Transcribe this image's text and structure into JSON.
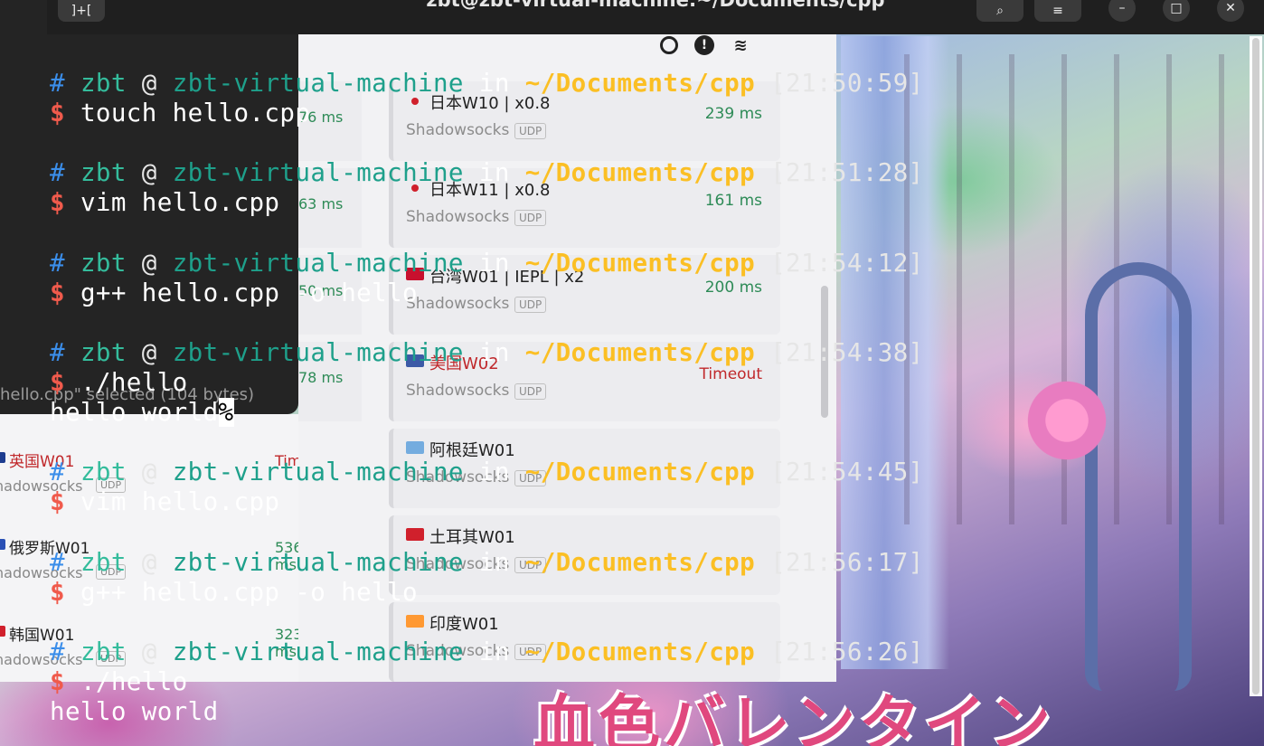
{
  "window": {
    "title": "zbt@zbt-virtual-machine:~/Documents/cpp",
    "new_tab_icon": "new-tab-icon",
    "search_icon": "search-icon",
    "menu_icon": "menu-icon",
    "minimize_icon": "minimize-icon",
    "maximize_icon": "maximize-icon",
    "close_icon": "close-icon"
  },
  "background_app": {
    "status_text": "hello.cpp\" selected (104 bytes)",
    "left_items": [
      {
        "name": "英国W01",
        "latency": "Timeout",
        "protocol": "hadowsocks",
        "badge": "UDP",
        "flag_color": "#1d3c8f",
        "red": true
      },
      {
        "name": "俄罗斯W01",
        "latency": "536 ms",
        "protocol": "hadowsocks",
        "badge": "UDP",
        "flag_color": "#2a50b5",
        "red": false
      },
      {
        "name": "韩国W01",
        "latency": "323 ms",
        "protocol": "hadowsocks",
        "badge": "UDP",
        "flag_color": "#d0202c",
        "red": false
      }
    ],
    "left_latencies": [
      "76 ms",
      "63 ms",
      "50 ms",
      "78 ms"
    ],
    "cards": [
      {
        "name": "日本W10 | x0.8",
        "protocol": "Shadowsocks",
        "badge": "UDP",
        "latency": "239 ms",
        "timeout": false,
        "red": false,
        "flag": "dot"
      },
      {
        "name": "日本W11 | x0.8",
        "protocol": "Shadowsocks",
        "badge": "UDP",
        "latency": "161 ms",
        "timeout": false,
        "red": false,
        "flag": "dot"
      },
      {
        "name": "台湾W01 | IEPL | x2",
        "protocol": "Shadowsocks",
        "badge": "UDP",
        "latency": "200 ms",
        "timeout": false,
        "red": false,
        "flag": "#c8102e"
      },
      {
        "name": "美国W02",
        "protocol": "Shadowsocks",
        "badge": "UDP",
        "latency": "Timeout",
        "timeout": true,
        "red": true,
        "flag": "#3c5aa6"
      },
      {
        "name": "阿根廷W01",
        "protocol": "Shadowsocks",
        "badge": "UDP",
        "latency": "",
        "timeout": false,
        "red": false,
        "flag": "#74acdf"
      },
      {
        "name": "土耳其W01",
        "protocol": "Shadowsocks",
        "badge": "UDP",
        "latency": "",
        "timeout": false,
        "red": false,
        "flag": "#d0202c"
      },
      {
        "name": "印度W01",
        "protocol": "Shadowsocks",
        "badge": "UDP",
        "latency": "",
        "timeout": false,
        "red": false,
        "flag": "#ff9933"
      }
    ]
  },
  "terminal": {
    "prompt": {
      "hash": "#",
      "user": "zbt",
      "at": "@",
      "host": "zbt-virtual-machine",
      "in": "in",
      "path": "~/Documents/cpp",
      "dollar": "$"
    },
    "blocks": [
      {
        "time": "[21:50:59]",
        "command": "touch hello.cpp",
        "output": []
      },
      {
        "time": "[21:51:28]",
        "command": "vim hello.cpp",
        "output": []
      },
      {
        "time": "[21:54:12]",
        "command": "g++ hello.cpp -o hello",
        "output": []
      },
      {
        "time": "[21:54:38]",
        "command": "./hello",
        "output": [
          "hello world"
        ],
        "no_newline_mark": "%"
      },
      {
        "time": "[21:54:45]",
        "command": "vim hello.cpp",
        "output": []
      },
      {
        "time": "[21:56:17]",
        "command": "g++ hello.cpp -o hello",
        "output": []
      },
      {
        "time": "[21:56:26]",
        "command": "./hello",
        "output": [
          "hello world"
        ]
      }
    ]
  },
  "wallpaper": {
    "title_text": "血色バレンタイン"
  }
}
